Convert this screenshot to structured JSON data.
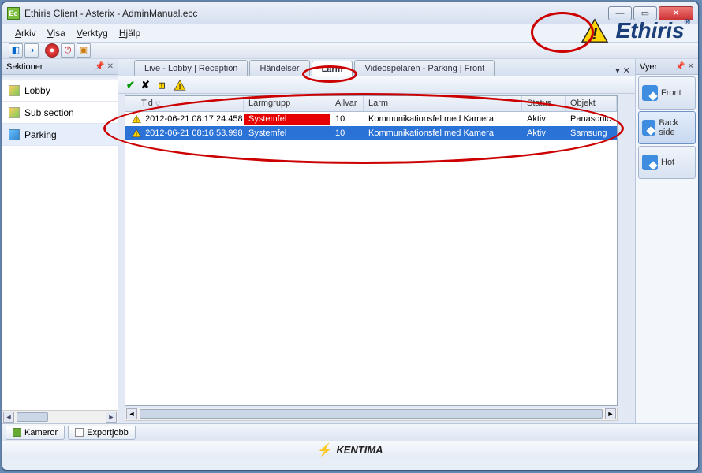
{
  "window": {
    "title": "Ethiris Client - Asterix - AdminManual.ecc"
  },
  "menu": {
    "items": [
      "Arkiv",
      "Visa",
      "Verktyg",
      "Hjälp"
    ]
  },
  "logo": {
    "text": "Ethiris",
    "reg": "®"
  },
  "left_panel": {
    "title": "Sektioner",
    "items": [
      {
        "label": "Lobby"
      },
      {
        "label": "Sub section"
      },
      {
        "label": "Parking"
      }
    ]
  },
  "tabs": {
    "items": [
      {
        "label": "Live - Lobby | Reception",
        "active": false
      },
      {
        "label": "Händelser",
        "active": false
      },
      {
        "label": "Larm",
        "active": true
      },
      {
        "label": "Videospelaren - Parking | Front",
        "active": false
      }
    ]
  },
  "grid": {
    "columns": {
      "tid": "Tid",
      "larmgrupp": "Larmgrupp",
      "allvar": "Allvar",
      "larm": "Larm",
      "status": "Status",
      "objekt": "Objekt"
    },
    "rows": [
      {
        "tid": "2012-06-21 08:17:24.458",
        "larmgrupp": "Systemfel",
        "allvar": "10",
        "larm": "Kommunikationsfel med Kamera",
        "status": "Aktiv",
        "objekt": "Panasonic",
        "style": "red"
      },
      {
        "tid": "2012-06-21 08:16:53.998",
        "larmgrupp": "Systemfel",
        "allvar": "10",
        "larm": "Kommunikationsfel med Kamera",
        "status": "Aktiv",
        "objekt": "Samsung",
        "style": "blue"
      }
    ]
  },
  "right_panel": {
    "title": "Vyer",
    "buttons": [
      {
        "label": "Front"
      },
      {
        "label": "Back side"
      },
      {
        "label": "Hot"
      }
    ]
  },
  "bottom_tabs": {
    "items": [
      {
        "label": "Kameror"
      },
      {
        "label": "Exportjobb"
      }
    ]
  },
  "footer": {
    "brand": "KENTIMA"
  },
  "icons": {
    "pin": "📌",
    "close": "✕",
    "dropdown": "▾",
    "check": "✔",
    "x": "✘",
    "left": "◄",
    "right": "►"
  }
}
